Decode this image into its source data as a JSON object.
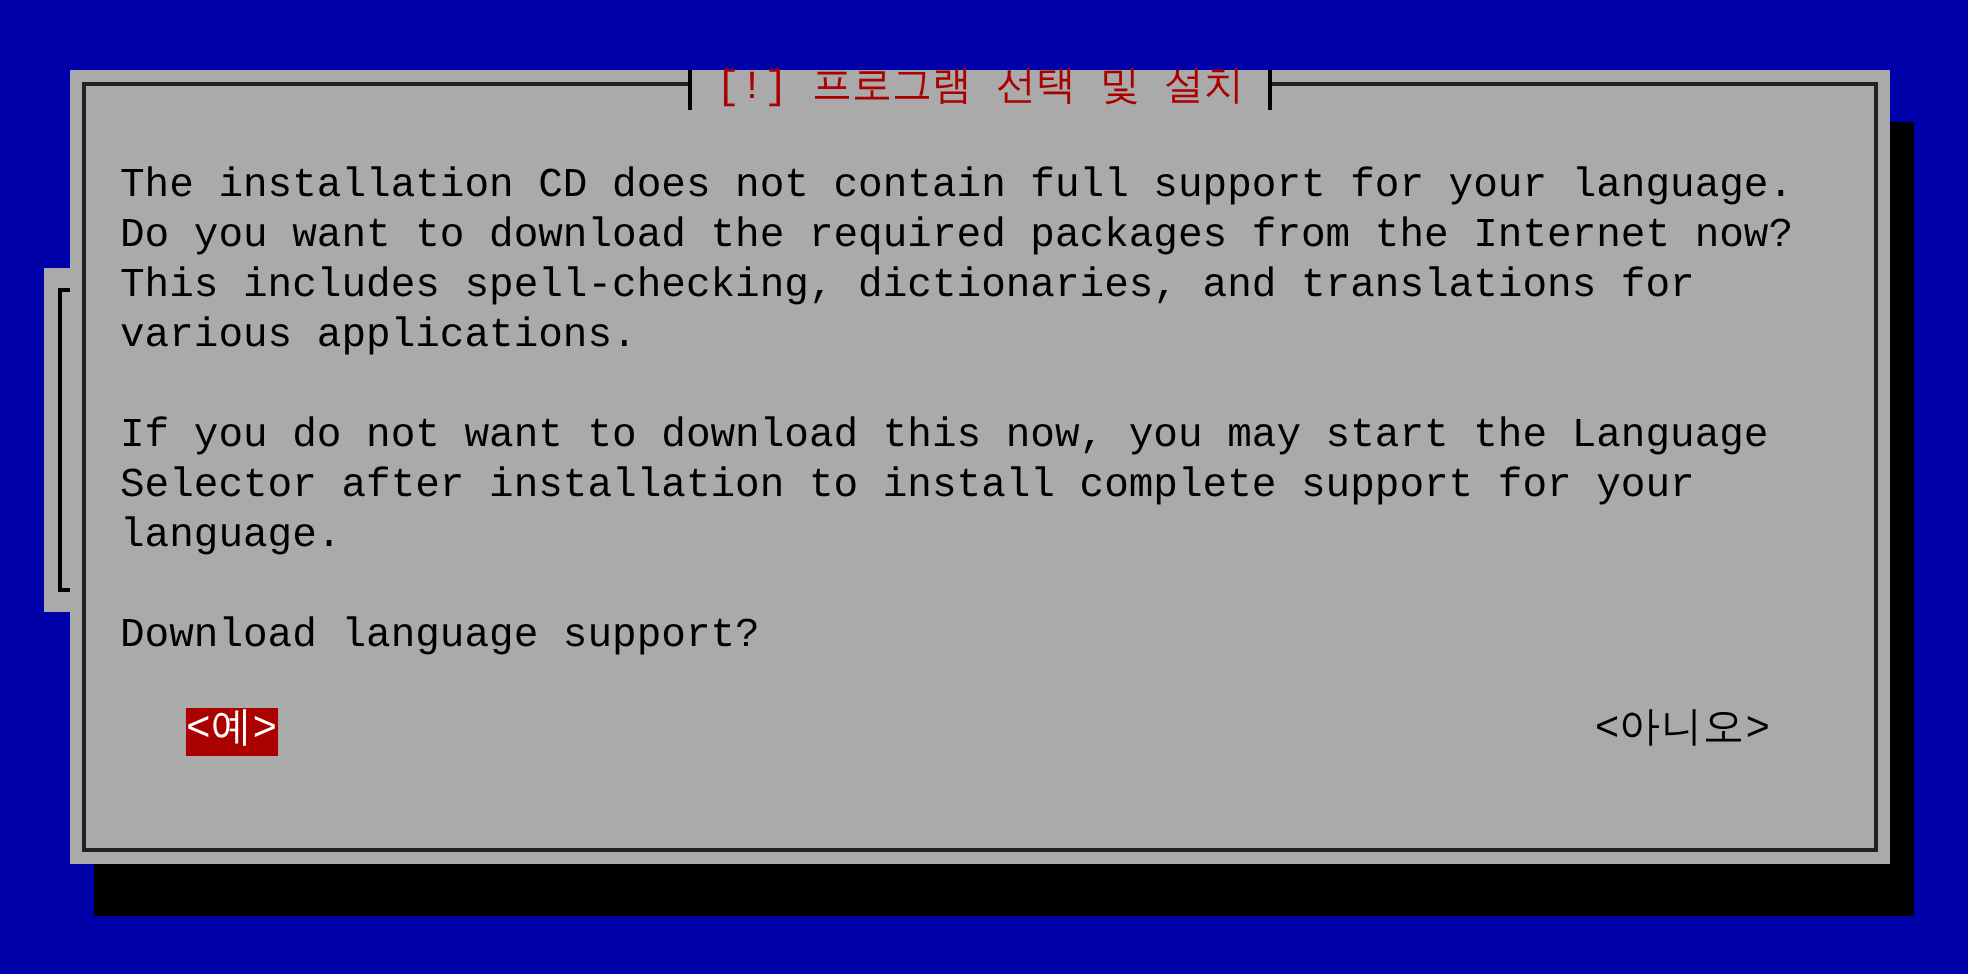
{
  "dialog": {
    "title": "[!] 프로그램 선택 및 설치",
    "paragraphs": [
      "The installation CD does not contain full support for your language. Do you want to download the required packages from the Internet now? This includes spell-checking, dictionaries, and translations for various applications.",
      "If you do not want to download this now, you may start the Language Selector after installation to install complete support for your language.",
      "Download language support?"
    ],
    "buttons": [
      {
        "label": "<예>",
        "selected": true
      },
      {
        "label": "<아니오>",
        "selected": false
      }
    ]
  }
}
